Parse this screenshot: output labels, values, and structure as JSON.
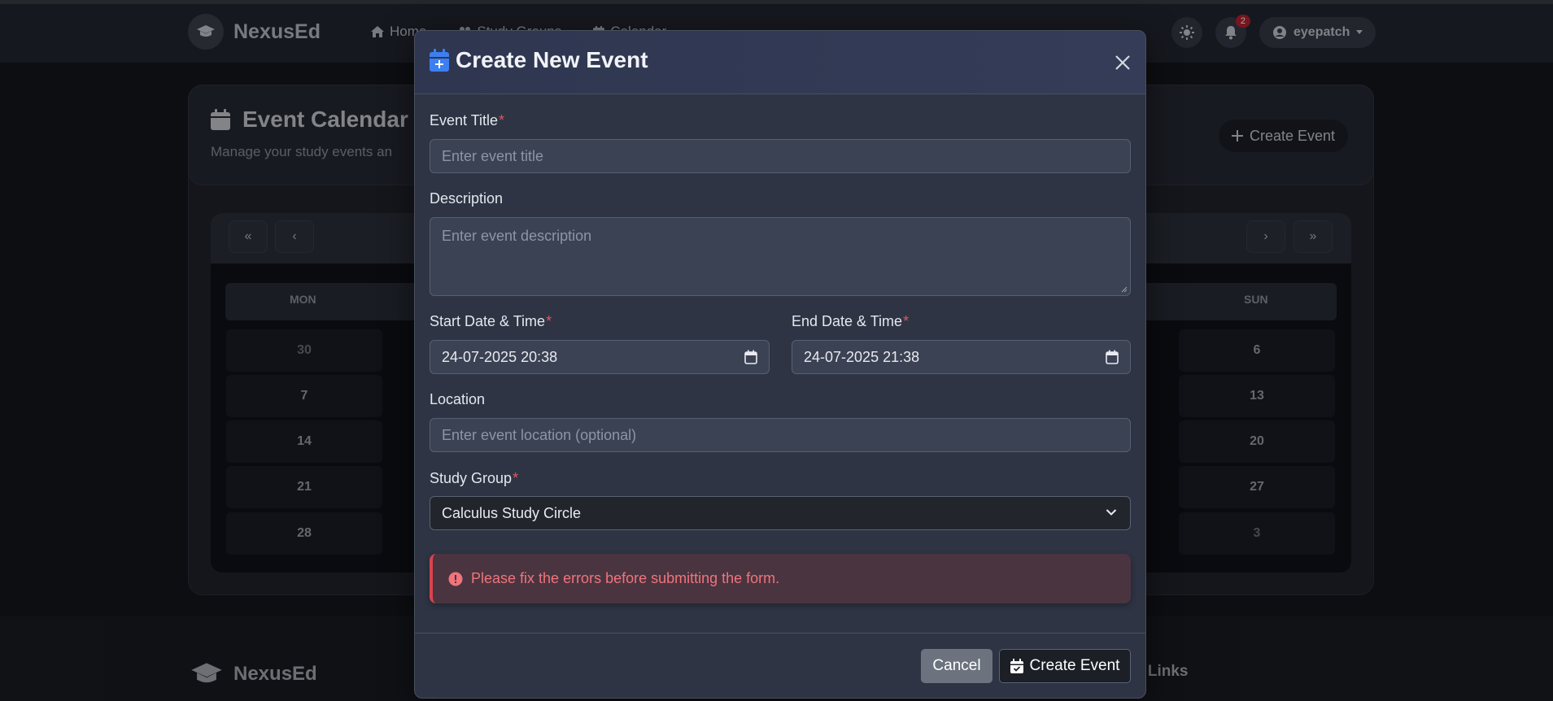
{
  "app": {
    "brand": "NexusEd",
    "nav": [
      "Home",
      "Study Groups",
      "Calendar"
    ],
    "notifications_count": "2",
    "user": "eyepatch"
  },
  "calendar": {
    "title": "Event Calendar",
    "subtitle": "Manage your study events an",
    "create_button": "Create Event",
    "nav_buttons": [
      "«",
      "‹",
      "›",
      "»"
    ],
    "weekdays": {
      "mon": "MON",
      "sun": "SUN"
    },
    "mon_days": [
      "30",
      "7",
      "14",
      "21",
      "28"
    ],
    "sun_days": [
      "6",
      "13",
      "20",
      "27",
      "3"
    ]
  },
  "modal": {
    "title": "Create New Event",
    "fields": {
      "title_label": "Event Title",
      "title_placeholder": "Enter event title",
      "description_label": "Description",
      "description_placeholder": "Enter event description",
      "start_label": "Start Date & Time",
      "start_value": "24-07-2025 20:38",
      "end_label": "End Date & Time",
      "end_value": "24-07-2025 21:38",
      "location_label": "Location",
      "location_placeholder": "Enter event location (optional)",
      "group_label": "Study Group",
      "group_value": "Calculus Study Circle"
    },
    "required_mark": "*",
    "error": "Please fix the errors before submitting the form.",
    "cancel": "Cancel",
    "submit": "Create Event"
  },
  "footer": {
    "brand": "NexusEd",
    "links_heading": "k Links"
  },
  "colors": {
    "accent": "#3d7ff2",
    "error": "#e05561",
    "modal_bg": "#2e3443"
  }
}
